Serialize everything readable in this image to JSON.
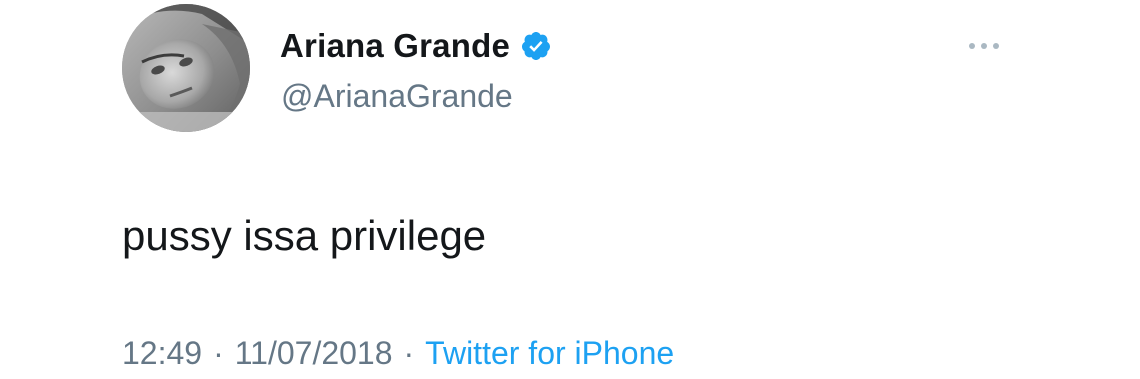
{
  "tweet": {
    "author": {
      "display_name": "Ariana Grande",
      "handle": "@ArianaGrande",
      "verified": true,
      "verified_icon": "verified-badge-icon",
      "avatar_icon": "profile-photo"
    },
    "text": "pussy issa privilege",
    "time": "12:49",
    "date": "11/07/2018",
    "separator": "·",
    "source": "Twitter for iPhone",
    "more_icon": "more-options-icon"
  },
  "colors": {
    "primary_text": "#14171a",
    "secondary_text": "#657786",
    "link": "#1da1f2",
    "verified_badge": "#1da1f2",
    "background": "#ffffff"
  }
}
